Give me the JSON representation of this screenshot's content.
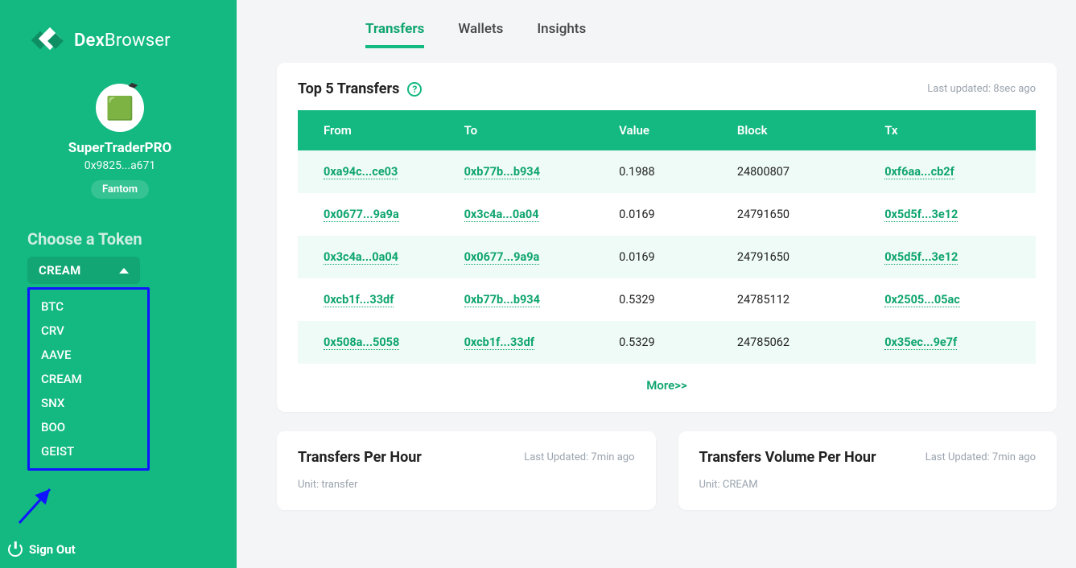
{
  "brand": {
    "bold": "Dex",
    "light": "Browser"
  },
  "profile": {
    "username": "SuperTraderPRO",
    "address": "0x9825...a671",
    "network": "Fantom"
  },
  "sidebar": {
    "choose_label": "Choose a Token",
    "selected_token": "CREAM",
    "tokens": [
      "BTC",
      "CRV",
      "AAVE",
      "CREAM",
      "SNX",
      "BOO",
      "GEIST"
    ],
    "signout_label": "Sign Out"
  },
  "tabs": {
    "items": [
      "Transfers",
      "Wallets",
      "Insights"
    ],
    "active": "Transfers"
  },
  "top_transfers": {
    "title": "Top 5 Transfers",
    "last_updated": "Last updated: 8sec ago",
    "more_label": "More>>",
    "columns": [
      "From",
      "To",
      "Value",
      "Block",
      "Tx"
    ],
    "rows": [
      {
        "from": "0xa94c...ce03",
        "to": "0xb77b...b934",
        "value": "0.1988",
        "block": "24800807",
        "tx": "0xf6aa...cb2f"
      },
      {
        "from": "0x0677...9a9a",
        "to": "0x3c4a...0a04",
        "value": "0.0169",
        "block": "24791650",
        "tx": "0x5d5f...3e12"
      },
      {
        "from": "0x3c4a...0a04",
        "to": "0x0677...9a9a",
        "value": "0.0169",
        "block": "24791650",
        "tx": "0x5d5f...3e12"
      },
      {
        "from": "0xcb1f...33df",
        "to": "0xb77b...b934",
        "value": "0.5329",
        "block": "24785112",
        "tx": "0x2505...05ac"
      },
      {
        "from": "0x508a...5058",
        "to": "0xcb1f...33df",
        "value": "0.5329",
        "block": "24785062",
        "tx": "0x35ec...9e7f"
      }
    ]
  },
  "panels": {
    "left": {
      "title": "Transfers Per Hour",
      "updated": "Last Updated: 7min ago",
      "unit": "Unit: transfer"
    },
    "right": {
      "title": "Transfers Volume Per Hour",
      "updated": "Last Updated: 7min ago",
      "unit": "Unit: CREAM"
    }
  }
}
